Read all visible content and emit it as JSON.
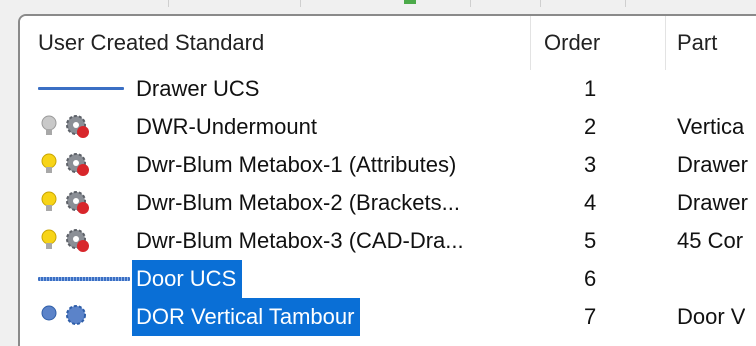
{
  "header": {
    "col_name": "User Created Standard",
    "col_order": "Order",
    "col_part": "Part"
  },
  "rows": [
    {
      "type": "ucs",
      "name": "Drawer UCS",
      "order": "1",
      "part": "",
      "selected": false
    },
    {
      "type": "item",
      "bulb": "off",
      "name": "DWR-Undermount",
      "order": "2",
      "part": "Vertica"
    },
    {
      "type": "item",
      "bulb": "on",
      "name": "Dwr-Blum Metabox-1 (Attributes)",
      "order": "3",
      "part": "Drawer"
    },
    {
      "type": "item",
      "bulb": "on",
      "name": "Dwr-Blum Metabox-2 (Brackets...",
      "order": "4",
      "part": "Drawer"
    },
    {
      "type": "item",
      "bulb": "on",
      "name": "Dwr-Blum Metabox-3 (CAD-Dra...",
      "order": "5",
      "part": "45 Cor"
    },
    {
      "type": "ucs",
      "name": "Door UCS",
      "order": "6",
      "part": "",
      "selected": true
    },
    {
      "type": "item",
      "bulb": "blue",
      "name": "DOR Vertical Tambour",
      "order": "7",
      "part": "Door V",
      "selected": true
    }
  ],
  "icons": {
    "bulb": "lightbulb-icon",
    "gear": "gear-icon",
    "ucs": "ucs-line-icon"
  },
  "colors": {
    "selection": "#0a6fd6",
    "bulb_on": "#f7d417",
    "bulb_off": "#c9c9c9",
    "ucs_line": "#3b6fc4"
  }
}
